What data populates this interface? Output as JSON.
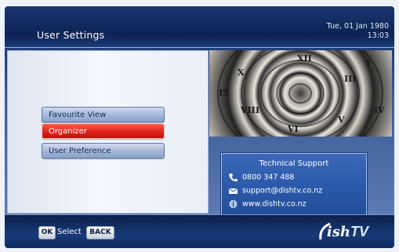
{
  "header": {
    "title": "User Settings",
    "date": "Tue, 01 Jan 1980",
    "time": "13:03"
  },
  "menu": {
    "items": [
      {
        "label": "Favourite View",
        "selected": false
      },
      {
        "label": "Organizer",
        "selected": true
      },
      {
        "label": "User Preference",
        "selected": false
      }
    ]
  },
  "support": {
    "title": "Technical Support",
    "phone": "0800 347 488",
    "email": "support@dishtv.co.nz",
    "website": "www.dishtv.co.nz"
  },
  "footer": {
    "ok_key": "OK",
    "ok_action": "Select",
    "back_key": "BACK"
  },
  "logo": {
    "brand": "ish",
    "tv": "TV"
  },
  "icons": {
    "phone": "phone-icon",
    "email": "envelope-icon",
    "web": "globe-icon",
    "picture": "spiral-clock-image"
  },
  "colors": {
    "header_bg": "#0d2352",
    "menu_selected": "#e0231a",
    "menu_normal": "#9fb3d5",
    "support_bg": "#2a58a8"
  }
}
